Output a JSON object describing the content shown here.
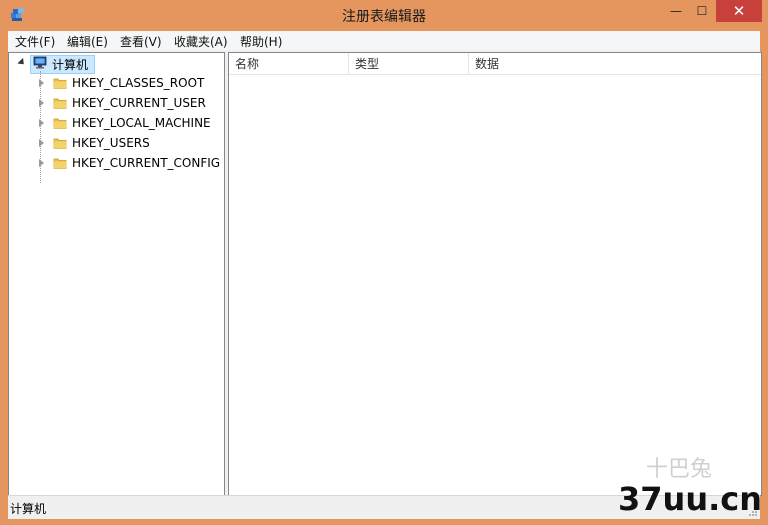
{
  "window": {
    "title": "注册表编辑器",
    "close_glyph": "✕",
    "max_glyph": "☐",
    "min_glyph": "—"
  },
  "menu": [
    {
      "label": "文件(F)"
    },
    {
      "label": "编辑(E)"
    },
    {
      "label": "查看(V)"
    },
    {
      "label": "收藏夹(A)"
    },
    {
      "label": "帮助(H)"
    }
  ],
  "tree": {
    "root": {
      "label": "计算机",
      "icon": "computer-icon",
      "expanded": true
    },
    "children": [
      {
        "label": "HKEY_CLASSES_ROOT",
        "icon": "folder-icon"
      },
      {
        "label": "HKEY_CURRENT_USER",
        "icon": "folder-icon"
      },
      {
        "label": "HKEY_LOCAL_MACHINE",
        "icon": "folder-icon"
      },
      {
        "label": "HKEY_USERS",
        "icon": "folder-icon"
      },
      {
        "label": "HKEY_CURRENT_CONFIG",
        "icon": "folder-icon"
      }
    ]
  },
  "list": {
    "columns": [
      {
        "label": "名称"
      },
      {
        "label": "类型"
      },
      {
        "label": "数据"
      }
    ]
  },
  "status": {
    "path": "计算机"
  },
  "watermark": {
    "text": "37uu.cn",
    "faint": "十巴兔"
  },
  "colors": {
    "window_frame": "#e5965f",
    "close_button": "#c7403b",
    "selection_fill": "#cce8ff",
    "selection_border": "#99d1ff",
    "folder": "#e8c04a"
  }
}
